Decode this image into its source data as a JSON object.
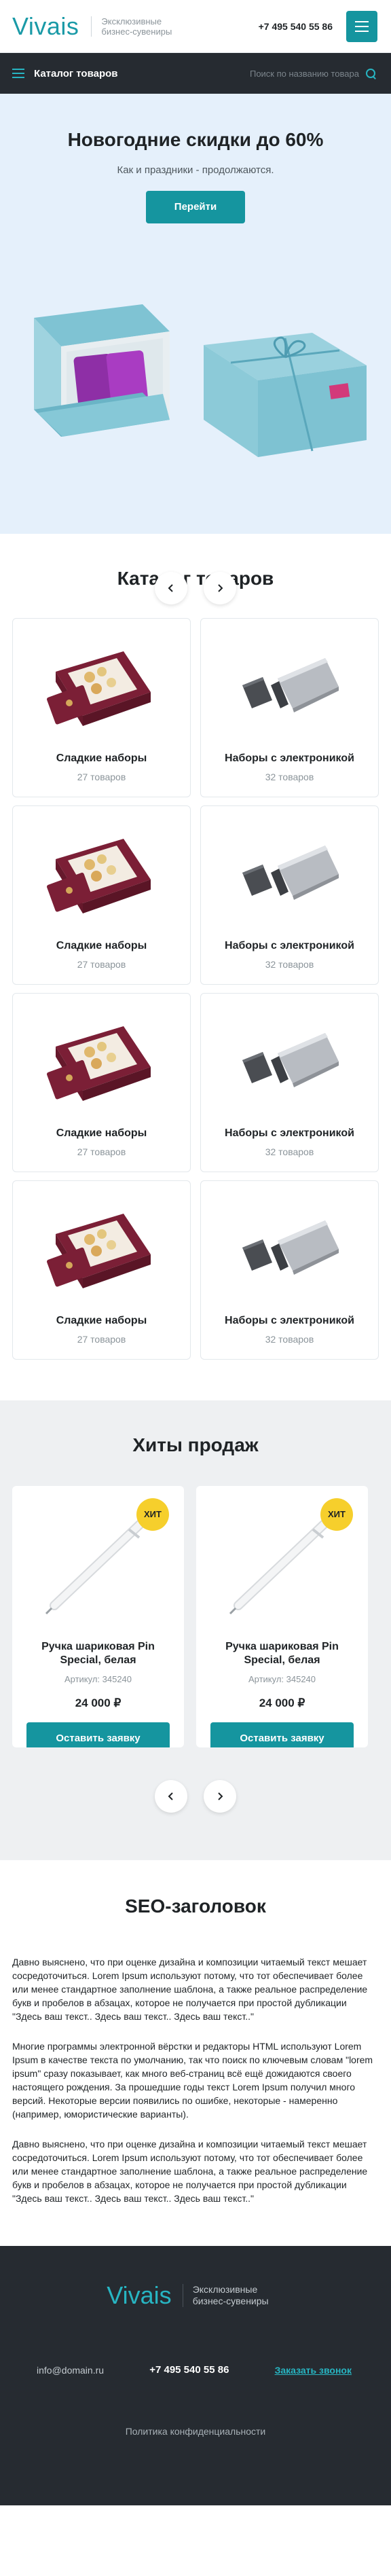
{
  "header": {
    "logo": "Vivais",
    "tagline": "Эксклюзивные бизнес-сувениры",
    "phone": "+7 495 540 55 86"
  },
  "catbar": {
    "label": "Каталог товаров",
    "search_placeholder": "Поиск по названию товара"
  },
  "hero": {
    "title": "Новогодние скидки до 60%",
    "subtitle": "Как и праздники - продолжаются.",
    "button": "Перейти"
  },
  "catalog": {
    "title": "Каталог товаров",
    "items": [
      {
        "name": "Сладкие наборы",
        "count": "27 товаров"
      },
      {
        "name": "Наборы с электроникой",
        "count": "32 товаров"
      },
      {
        "name": "Сладкие наборы",
        "count": "27 товаров"
      },
      {
        "name": "Наборы с электроникой",
        "count": "32 товаров"
      },
      {
        "name": "Сладкие наборы",
        "count": "27 товаров"
      },
      {
        "name": "Наборы с электроникой",
        "count": "32 товаров"
      },
      {
        "name": "Сладкие наборы",
        "count": "27 товаров"
      },
      {
        "name": "Наборы с электроникой",
        "count": "32 товаров"
      }
    ]
  },
  "hits": {
    "title": "Хиты продаж",
    "items": [
      {
        "badge": "ХИТ",
        "name": "Ручка шариковая Pin Special, белая",
        "sku": "Артикул: 345240",
        "price": "24 000 ₽",
        "button": "Оставить заявку"
      },
      {
        "badge": "ХИТ",
        "name": "Ручка шариковая Pin Special, белая",
        "sku": "Артикул: 345240",
        "price": "24 000 ₽",
        "button": "Оставить заявку"
      }
    ]
  },
  "seo": {
    "title": "SEO-заголовок",
    "paragraphs": [
      "Давно выяснено, что при оценке дизайна и композиции читаемый текст мешает сосредоточиться. Lorem Ipsum используют потому, что тот обеспечивает более или менее стандартное заполнение шаблона, а также реальное распределение букв и пробелов в абзацах, которое не получается при простой дубликации \"Здесь ваш текст.. Здесь ваш текст.. Здесь ваш текст..\"",
      "Многие программы электронной вёрстки и редакторы HTML используют Lorem Ipsum в качестве текста по умолчанию, так что поиск по ключевым словам \"lorem ipsum\" сразу показывает, как много веб-страниц всё ещё дожидаются своего настоящего рождения. За прошедшие годы текст Lorem Ipsum получил много версий. Некоторые версии появились по ошибке, некоторые - намеренно (например, юмористические варианты).",
      "Давно выяснено, что при оценке дизайна и композиции читаемый текст мешает сосредоточиться. Lorem Ipsum используют потому, что тот обеспечивает более или менее стандартное заполнение шаблона, а также реальное распределение букв и пробелов в абзацах, которое не получается при простой дубликации \"Здесь ваш текст.. Здесь ваш текст.. Здесь ваш текст..\""
    ]
  },
  "footer": {
    "logo": "Vivais",
    "tagline": "Эксклюзивные бизнес-сувениры",
    "email": "info@domain.ru",
    "phone": "+7 495 540 55 86",
    "call": "Заказать звонок",
    "policy": "Политика конфиденциальности"
  },
  "colors": {
    "accent": "#15959f",
    "dark": "#262b31",
    "hero_bg": "#e5f0fb",
    "badge": "#f6cf2c"
  }
}
